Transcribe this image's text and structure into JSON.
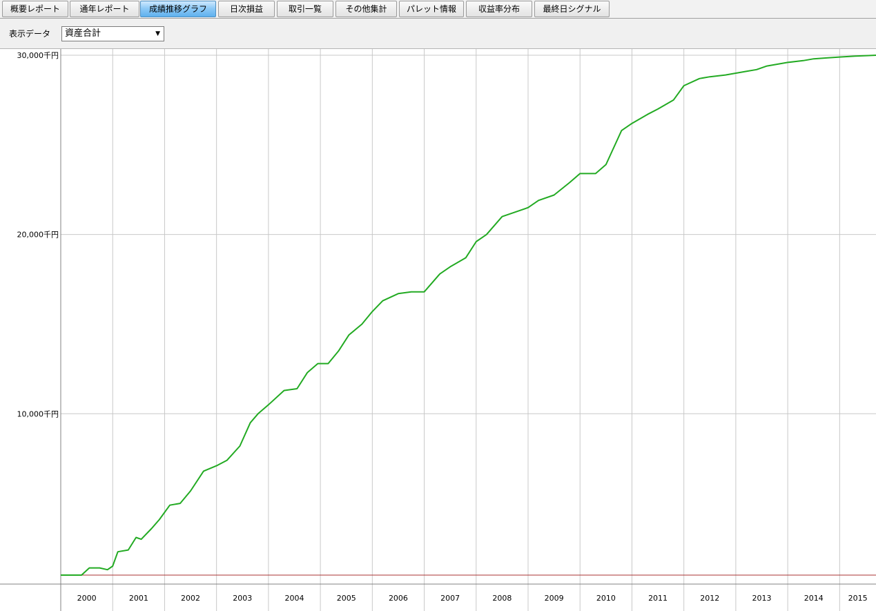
{
  "tabs": [
    {
      "label": "概要レポート",
      "active": false
    },
    {
      "label": "通年レポート",
      "active": false
    },
    {
      "label": "成績推移グラフ",
      "active": true
    },
    {
      "label": "日次損益",
      "active": false
    },
    {
      "label": "取引一覧",
      "active": false
    },
    {
      "label": "その他集計",
      "active": false
    },
    {
      "label": "パレット情報",
      "active": false
    },
    {
      "label": "収益率分布",
      "active": false
    },
    {
      "label": "最終日シグナル",
      "active": false
    }
  ],
  "toolbar": {
    "display_label": "表示データ",
    "display_value": "資産合計"
  },
  "colors": {
    "series": "#22aa22",
    "baseline": "#a83232",
    "grid": "#c8c8c8",
    "active_tab": "#5fb1ee"
  },
  "chart_data": {
    "type": "line",
    "title": "",
    "xlabel": "",
    "ylabel": "",
    "y_unit": "千円",
    "y_ticks": [
      "30,000千円",
      "20,000千円",
      "10,000千円"
    ],
    "y_tick_values": [
      30000,
      20000,
      10000
    ],
    "ylim": [
      1000,
      30000
    ],
    "x_tick_labels": [
      "2000",
      "2001",
      "2002",
      "2003",
      "2004",
      "2005",
      "2006",
      "2007",
      "2008",
      "2009",
      "2010",
      "2011",
      "2012",
      "2013",
      "2014",
      "2015"
    ],
    "xlim": [
      2000.0,
      2015.7
    ],
    "grid": true,
    "legend": "none",
    "baseline_value": 1000,
    "series": [
      {
        "x": [
          2000.0,
          2000.4,
          2000.55,
          2000.75,
          2000.9,
          2001.0,
          2001.1,
          2001.3,
          2001.45,
          2001.55,
          2001.75,
          2001.9,
          2002.1,
          2002.3,
          2002.5,
          2002.75,
          2003.0,
          2003.2,
          2003.45,
          2003.65,
          2003.8,
          2004.0,
          2004.3,
          2004.55,
          2004.75,
          2004.95,
          2005.15,
          2005.35,
          2005.55,
          2005.8,
          2006.0,
          2006.2,
          2006.5,
          2006.75,
          2007.0,
          2007.3,
          2007.5,
          2007.8,
          2008.0,
          2008.2,
          2008.5,
          2008.8,
          2009.0,
          2009.2,
          2009.5,
          2009.8,
          2010.0,
          2010.3,
          2010.5,
          2010.8,
          2011.0,
          2011.3,
          2011.5,
          2011.8,
          2012.0,
          2012.3,
          2012.5,
          2012.8,
          2013.0,
          2013.2,
          2013.4,
          2013.5,
          2013.6,
          2013.8,
          2014.0,
          2014.3,
          2014.5,
          2014.75,
          2015.0,
          2015.3,
          2015.55,
          2015.7
        ],
        "values": [
          1000,
          1000,
          1400,
          1400,
          1300,
          1500,
          2300,
          2400,
          3100,
          3000,
          3600,
          4100,
          4900,
          5000,
          5700,
          6800,
          7100,
          7400,
          8200,
          9500,
          10000,
          10500,
          11300,
          11400,
          12300,
          12800,
          12800,
          13500,
          14400,
          15000,
          15700,
          16300,
          16700,
          16800,
          16800,
          17800,
          18200,
          18700,
          19600,
          20000,
          21000,
          21300,
          21500,
          21900,
          22200,
          22900,
          23400,
          23400,
          23900,
          25800,
          26200,
          26700,
          27000,
          27500,
          28300,
          28700,
          28800,
          28900,
          29000,
          29100,
          29200,
          29300,
          29400,
          29500,
          29600,
          29700,
          29800,
          29850,
          29900,
          29950,
          29980,
          30000
        ]
      }
    ]
  }
}
